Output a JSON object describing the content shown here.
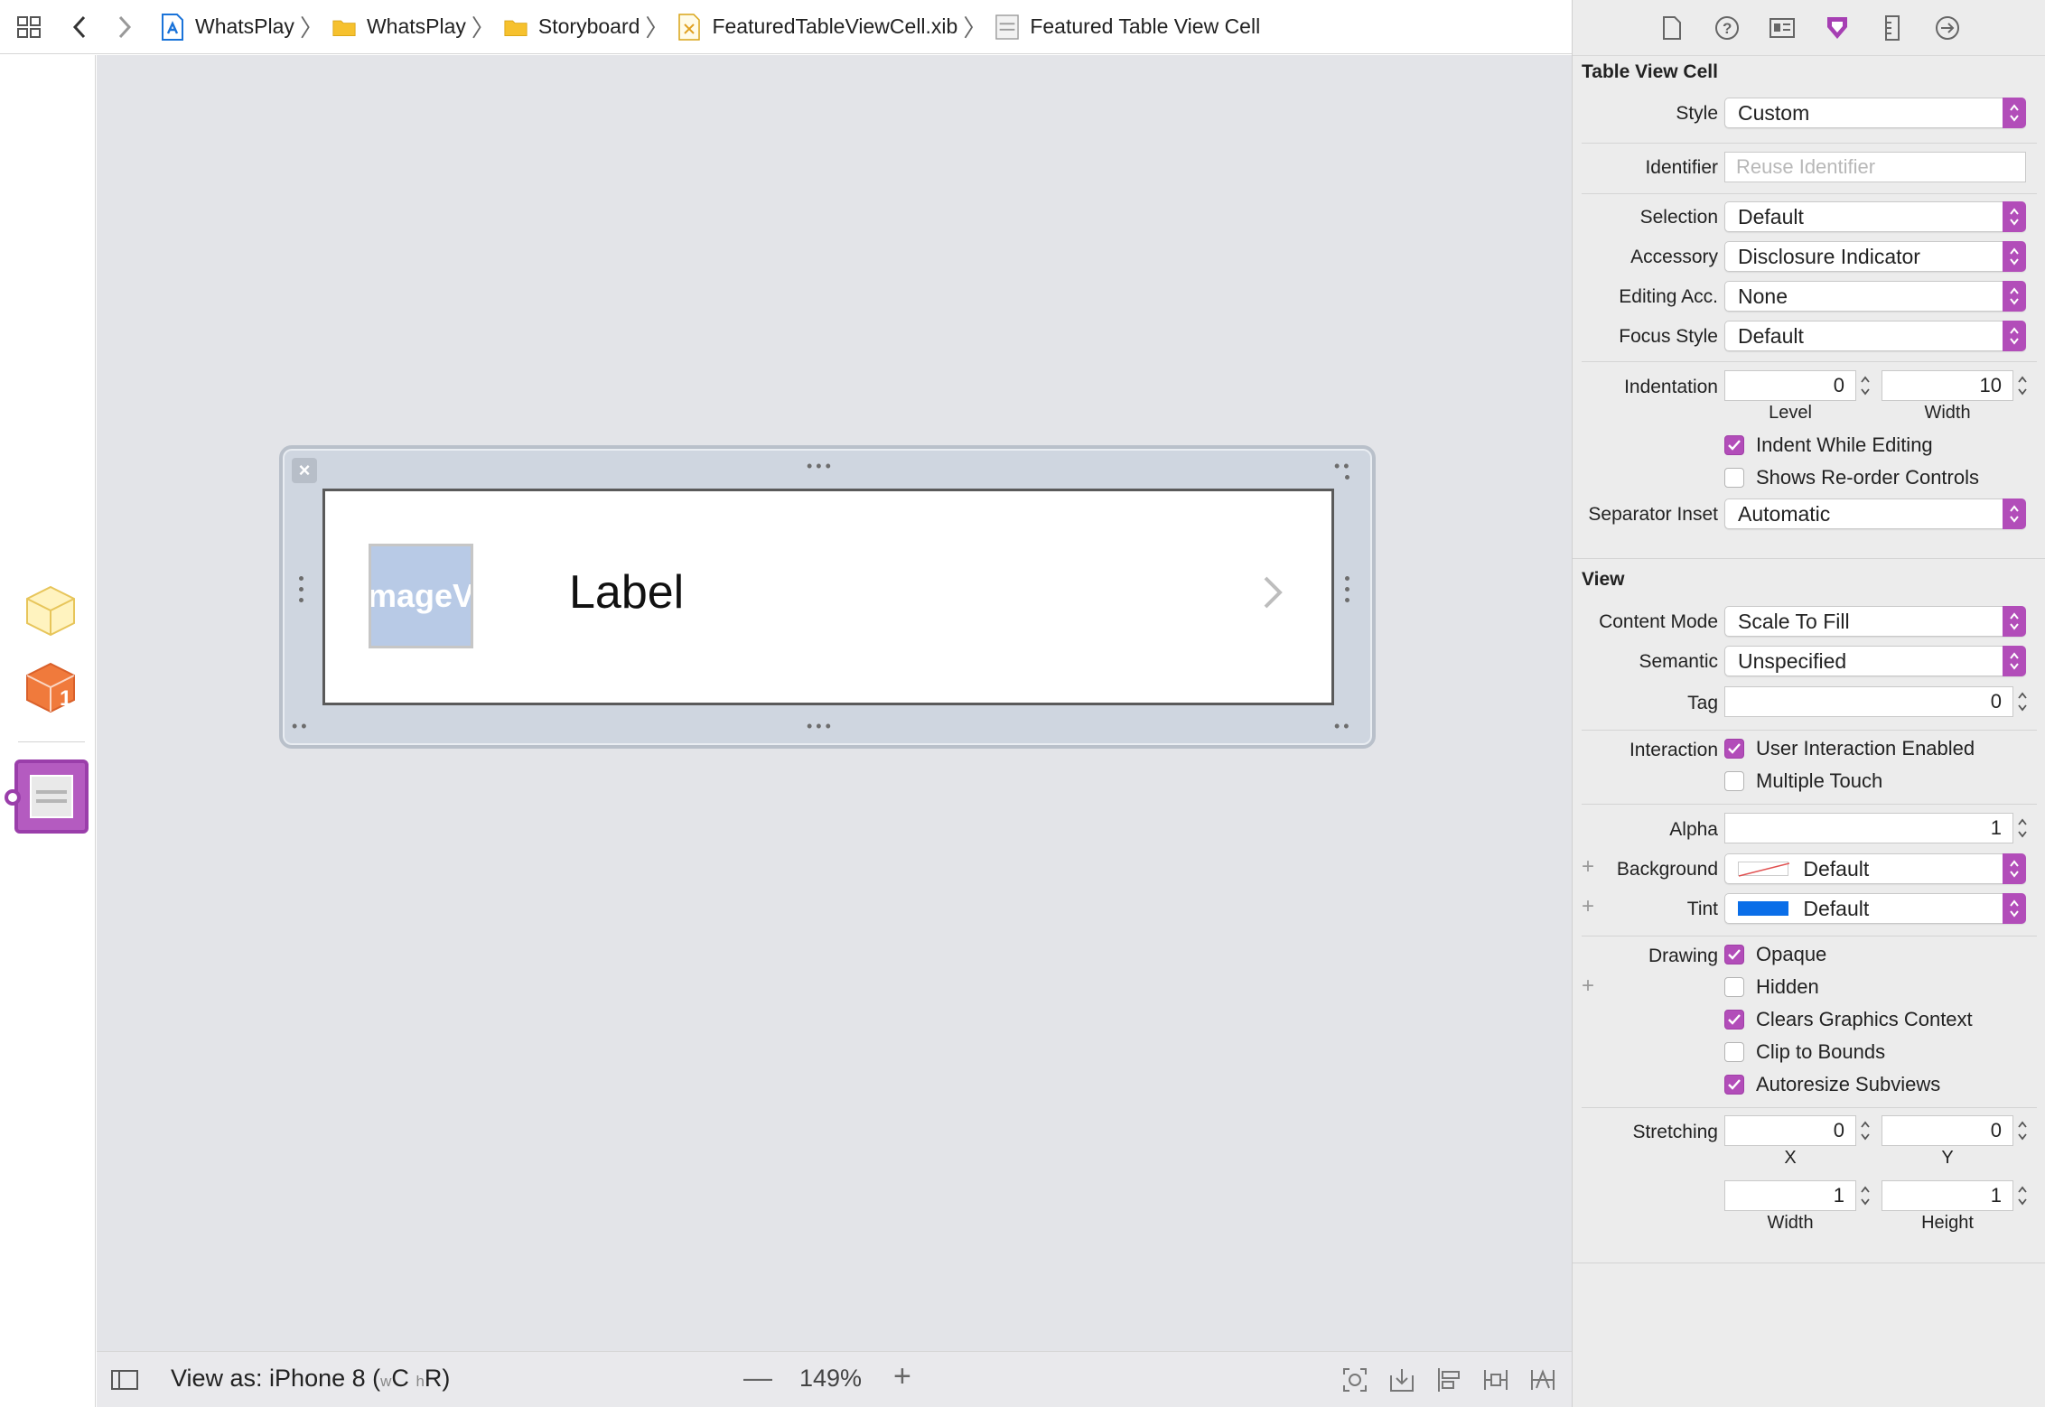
{
  "breadcrumb": [
    {
      "label": "WhatsPlay",
      "icon": "xcode-project-icon"
    },
    {
      "label": "WhatsPlay",
      "icon": "folder-icon"
    },
    {
      "label": "Storyboard",
      "icon": "folder-icon"
    },
    {
      "label": "FeaturedTableViewCell.xib",
      "icon": "xib-file-icon"
    },
    {
      "label": "Featured Table View Cell",
      "icon": "table-cell-icon"
    }
  ],
  "canvas": {
    "image_view_text": "mageV",
    "label_text": "Label"
  },
  "bottom_bar": {
    "view_as_prefix": "View as: iPhone 8 (",
    "size_w": "w",
    "size_c": "C",
    "size_h": "h",
    "size_r": "R)",
    "zoom": "149%",
    "zoom_out": "—",
    "zoom_in": "+"
  },
  "inspector": {
    "cell_section": {
      "title": "Table View Cell",
      "style": {
        "label": "Style",
        "value": "Custom"
      },
      "identifier": {
        "label": "Identifier",
        "placeholder": "Reuse Identifier"
      },
      "selection": {
        "label": "Selection",
        "value": "Default"
      },
      "accessory": {
        "label": "Accessory",
        "value": "Disclosure Indicator"
      },
      "editing_acc": {
        "label": "Editing Acc.",
        "value": "None"
      },
      "focus_style": {
        "label": "Focus Style",
        "value": "Default"
      },
      "indentation": {
        "label": "Indentation",
        "level": "0",
        "level_label": "Level",
        "width": "10",
        "width_label": "Width"
      },
      "indent_while_editing": {
        "label": "Indent While Editing",
        "checked": true
      },
      "shows_reorder": {
        "label": "Shows Re-order Controls",
        "checked": false
      },
      "separator_inset": {
        "label": "Separator Inset",
        "value": "Automatic"
      }
    },
    "view_section": {
      "title": "View",
      "content_mode": {
        "label": "Content Mode",
        "value": "Scale To Fill"
      },
      "semantic": {
        "label": "Semantic",
        "value": "Unspecified"
      },
      "tag": {
        "label": "Tag",
        "value": "0"
      },
      "interaction": {
        "label": "Interaction"
      },
      "user_interaction": {
        "label": "User Interaction Enabled",
        "checked": true
      },
      "multiple_touch": {
        "label": "Multiple Touch",
        "checked": false
      },
      "alpha": {
        "label": "Alpha",
        "value": "1"
      },
      "background": {
        "label": "Background",
        "value": "Default"
      },
      "tint": {
        "label": "Tint",
        "value": "Default",
        "color": "#0a6ee8"
      },
      "drawing": {
        "label": "Drawing"
      },
      "opaque": {
        "label": "Opaque",
        "checked": true
      },
      "hidden": {
        "label": "Hidden",
        "checked": false
      },
      "clears_graphics": {
        "label": "Clears Graphics Context",
        "checked": true
      },
      "clip_to_bounds": {
        "label": "Clip to Bounds",
        "checked": false
      },
      "autoresize": {
        "label": "Autoresize Subviews",
        "checked": true
      },
      "stretching": {
        "label": "Stretching",
        "x": "0",
        "x_label": "X",
        "y": "0",
        "y_label": "Y",
        "w": "1",
        "w_label": "Width",
        "h": "1",
        "h_label": "Height"
      }
    }
  },
  "colors": {
    "accent": "#b24db9",
    "canvas": "#e3e4e8"
  }
}
